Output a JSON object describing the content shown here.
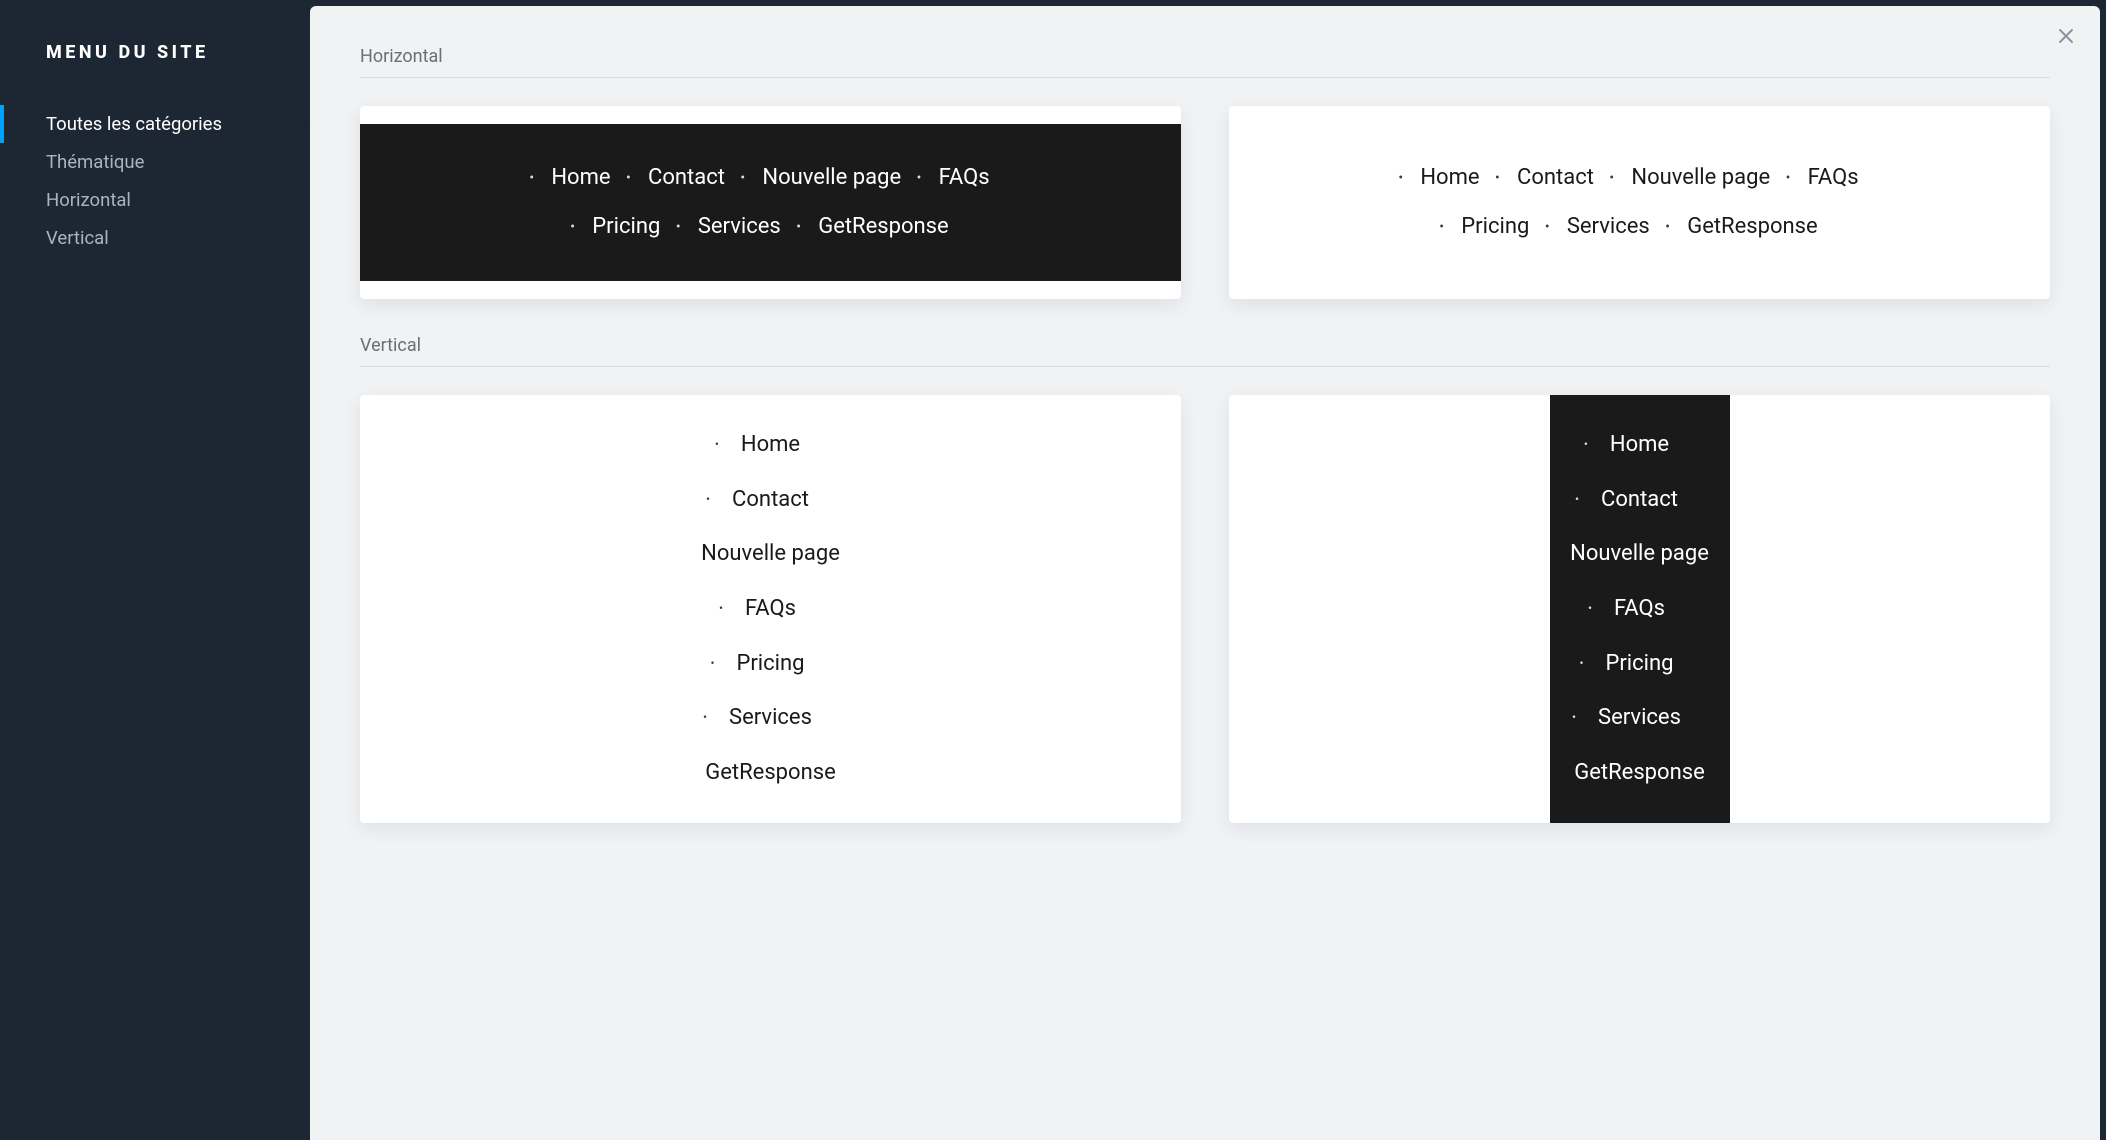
{
  "sidebar": {
    "title": "MENU DU SITE",
    "items": [
      {
        "label": "Toutes les catégories",
        "active": true
      },
      {
        "label": "Thématique",
        "active": false
      },
      {
        "label": "Horizontal",
        "active": false
      },
      {
        "label": "Vertical",
        "active": false
      }
    ]
  },
  "sections": [
    {
      "title": "Horizontal"
    },
    {
      "title": "Vertical"
    }
  ],
  "menu_items": [
    {
      "label": "Home",
      "bullet": true
    },
    {
      "label": "Contact",
      "bullet": true
    },
    {
      "label": "Nouvelle page",
      "bullet": false
    },
    {
      "label": "FAQs",
      "bullet": true
    },
    {
      "label": "Pricing",
      "bullet": true
    },
    {
      "label": "Services",
      "bullet": true
    },
    {
      "label": "GetResponse",
      "bullet": false
    }
  ],
  "close_label": "Close"
}
